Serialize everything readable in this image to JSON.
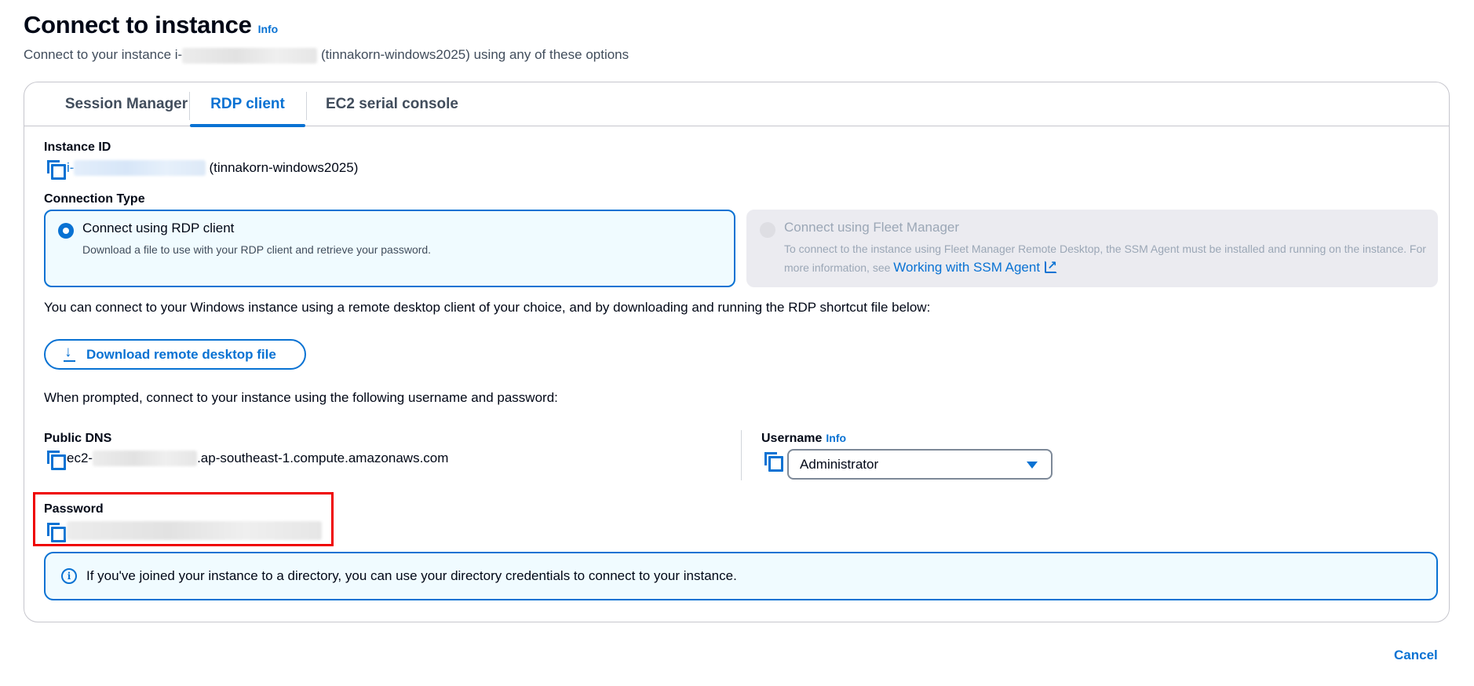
{
  "header": {
    "title": "Connect to instance",
    "info_label": "Info",
    "subtitle_prefix": "Connect to your instance i-",
    "subtitle_suffix": "(tinnakorn-windows2025) using any of these options"
  },
  "tabs": [
    {
      "label": "Session Manager",
      "active": false
    },
    {
      "label": "RDP client",
      "active": true
    },
    {
      "label": "EC2 serial console",
      "active": false
    }
  ],
  "instance": {
    "label": "Instance ID",
    "id_prefix": "i-",
    "name": "(tinnakorn-windows2025)"
  },
  "connection_type": {
    "label": "Connection Type",
    "options": [
      {
        "title": "Connect using RDP client",
        "description": "Download a file to use with your RDP client and retrieve your password.",
        "selected": true,
        "disabled": false
      },
      {
        "title": "Connect using Fleet Manager",
        "description": "To connect to the instance using Fleet Manager Remote Desktop, the SSM Agent must be installed and running on the instance. For more information, see",
        "link_text": "Working with SSM Agent",
        "selected": false,
        "disabled": true
      }
    ]
  },
  "rdp": {
    "intro": "You can connect to your Windows instance using a remote desktop client of your choice, and by downloading and running the RDP shortcut file below:",
    "download_button": "Download remote desktop file",
    "prompt": "When prompted, connect to your instance using the following username and password:"
  },
  "public_dns": {
    "label": "Public DNS",
    "prefix": "ec2-",
    "suffix": ".ap-southeast-1.compute.amazonaws.com"
  },
  "username": {
    "label": "Username",
    "info_label": "Info",
    "selected": "Administrator"
  },
  "password": {
    "label": "Password",
    "highlighted": true
  },
  "alert": {
    "text": "If you've joined your instance to a directory, you can use your directory credentials to connect to your instance."
  },
  "footer": {
    "cancel_label": "Cancel"
  },
  "colors": {
    "accent": "#0972d3",
    "highlight": "#ef0000",
    "alert_bg": "#f0fbff",
    "disabled_bg": "#ebebf0"
  }
}
